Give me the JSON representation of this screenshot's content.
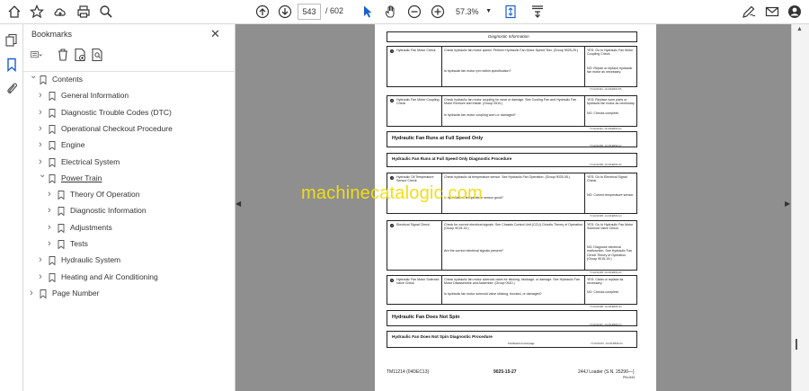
{
  "toolbar": {
    "page_current": "543",
    "page_total": "/ 602",
    "zoom": "57.3%"
  },
  "panel": {
    "title": "Bookmarks",
    "close": "✕"
  },
  "bookmarks": [
    {
      "label": "Contents",
      "expanded": true
    },
    {
      "label": "General Information"
    },
    {
      "label": "Diagnostic Trouble Codes (DTC)"
    },
    {
      "label": "Operational Checkout Procedure"
    },
    {
      "label": "Engine"
    },
    {
      "label": "Electrical System"
    },
    {
      "label": "Power Train",
      "expanded": true
    },
    {
      "label": "Theory Of Operation"
    },
    {
      "label": "Diagnostic Information"
    },
    {
      "label": "Adjustments"
    },
    {
      "label": "Tests"
    },
    {
      "label": "Hydraulic System"
    },
    {
      "label": "Heating and Air Conditioning"
    },
    {
      "label": "Page Number"
    }
  ],
  "watermark": "machinecatalogic.com",
  "document": {
    "top_header": "Diagnostic Information",
    "rows": [
      {
        "step": "1",
        "name": "Hydraulic Fan Motor Check",
        "action": "Check hydraulic fan motor speed. Perform Hydraulic Fan Motor Speed Test. (Group 9025-25.)",
        "question": "Is hydraulic fan motor rpm within specification?",
        "yes": "YES: Go to Hydraulic Fan Motor Coupling Check.",
        "no": "NO: Repair or replace hydraulic fan motor as necessary.",
        "code": "TX1123240A ‑19‑04FEB09‑5/5"
      },
      {
        "step": "2",
        "name": "Hydraulic Fan Motor Coupling Check",
        "action": "Check hydraulic fan motor coupling for wear or damage. See Cooling Fan and Hydraulic Fan Motor Remove and Install. (Group 0510.)",
        "question": "Is hydraulic fan motor coupling worn or damaged?",
        "yes": "YES: Replace worn parts or hydraulic fan motor as necessary.",
        "no": "NO: Checks complete.",
        "code": "TX1123240A ‑19‑04FEB09‑4/4"
      }
    ],
    "section1_title": "Hydraulic Fan Runs at Full Speed Only",
    "section1_code": "TX1123240B ‑19‑04FEB09‑1/2",
    "proc1_title": "Hydraulic Fan Runs at Full Speed Only Diagnostic Procedure",
    "proc1_code": "TX1123240B ‑19‑04FEB09‑2/2",
    "rows2": [
      {
        "step": "1",
        "name": "Hydraulic Oil Temperature Sensor Check",
        "action": "Check hydraulic oil temperature sensor. See Hydraulic Fan Operation. (Group 9025-05.)",
        "question": "Is hydraulic oil temperature sensor good?",
        "yes": "YES: Go to Electrical Signal Check.",
        "no": "NO: Correct temperature sensor.",
        "code": "TX1123240B ‑19‑04FEB09‑1/3"
      },
      {
        "step": "2",
        "name": "Electrical Signal Check",
        "action": "Check for correct electrical signals. See Chassis Control Unit (CCU) Circuits Theory of Operation. (Group 9015-15.)",
        "question": "Are the correct electrical signals present?",
        "yes": "YES: Go to Hydraulic Fan Motor Solenoid Valve Check.",
        "no": "NO: Diagnose electrical malfunction. See Hydraulic Fan Circuit Theory of Operation. (Group 9015-15.)",
        "code": "TX1123240B ‑19‑04FEB09‑2/3"
      },
      {
        "step": "3",
        "name": "Hydraulic Fan Motor Solenoid Valve Check",
        "action": "Check hydraulic fan motor solenoid valve for sticking, blockage, or damage. See Hydraulic Fan Motor Disassemble and Assemble. (Group 0510.)",
        "question": "Is hydraulic fan motor solenoid valve sticking, blocked, or damaged?",
        "yes": "YES: Clean or replace as necessary.",
        "no": "NO: Checks complete.",
        "code": "TX1123240B ‑19‑04FEB09‑3/3"
      }
    ],
    "section2_title": "Hydraulic Fan Does Not Spin",
    "section2_code": "TX1123240C ‑19‑04FEB09‑1/2",
    "proc2_title": "Hydraulic Fan Does Not Spin Diagnostic Procedure",
    "proc2_note": "Continued on next page",
    "proc2_code": "TX1123240C ‑19‑04FEB09‑2/2",
    "footer_left": "TM11214 (04DEC13)",
    "footer_center": "9025-15-27",
    "footer_right": "244J Loader (S.N. 25290—)",
    "footer_right2": "PN=543"
  }
}
